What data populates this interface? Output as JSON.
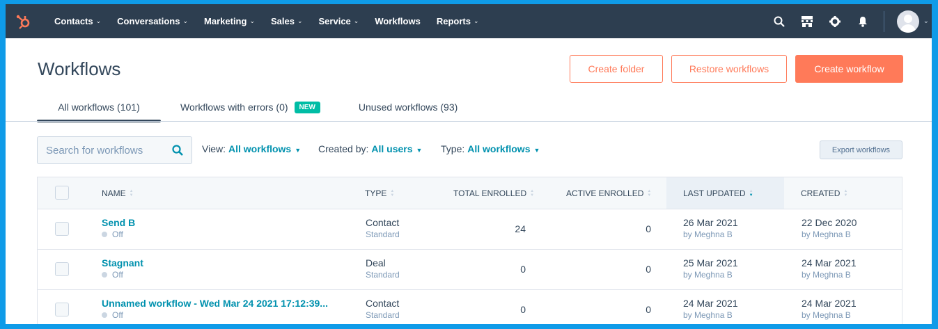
{
  "nav": {
    "items": [
      {
        "label": "Contacts",
        "has_dropdown": true
      },
      {
        "label": "Conversations",
        "has_dropdown": true
      },
      {
        "label": "Marketing",
        "has_dropdown": true
      },
      {
        "label": "Sales",
        "has_dropdown": true
      },
      {
        "label": "Service",
        "has_dropdown": true
      },
      {
        "label": "Workflows",
        "has_dropdown": false
      },
      {
        "label": "Reports",
        "has_dropdown": true
      }
    ],
    "icons": [
      "search-icon",
      "marketplace-icon",
      "settings-icon",
      "notifications-icon"
    ],
    "chevron": "⌄"
  },
  "header": {
    "title": "Workflows",
    "create_folder_label": "Create folder",
    "restore_label": "Restore workflows",
    "create_workflow_label": "Create workflow"
  },
  "tabs": [
    {
      "label": "All workflows (101)",
      "active": true
    },
    {
      "label": "Workflows with errors (0)",
      "badge": "NEW"
    },
    {
      "label": "Unused workflows (93)"
    }
  ],
  "filters": {
    "search_placeholder": "Search for workflows",
    "view_label": "View:",
    "view_value": "All workflows",
    "created_by_label": "Created by:",
    "created_by_value": "All users",
    "type_label": "Type:",
    "type_value": "All workflows",
    "export_label": "Export workflows"
  },
  "table": {
    "columns": {
      "name": "NAME",
      "type": "TYPE",
      "total_enrolled": "TOTAL ENROLLED",
      "active_enrolled": "ACTIVE ENROLLED",
      "last_updated": "LAST UPDATED",
      "created": "CREATED"
    },
    "sorted_column": "last_updated",
    "rows": [
      {
        "name": "Send B",
        "status": "Off",
        "type": "Contact",
        "subtype": "Standard",
        "total_enrolled": "24",
        "active_enrolled": "0",
        "last_updated": "26 Mar 2021",
        "last_updated_by": "by Meghna B",
        "created": "22 Dec 2020",
        "created_by": "by Meghna B"
      },
      {
        "name": "Stagnant",
        "status": "Off",
        "type": "Deal",
        "subtype": "Standard",
        "total_enrolled": "0",
        "active_enrolled": "0",
        "last_updated": "25 Mar 2021",
        "last_updated_by": "by Meghna B",
        "created": "24 Mar 2021",
        "created_by": "by Meghna B"
      },
      {
        "name": "Unnamed workflow - Wed Mar 24 2021 17:12:39...",
        "status": "Off",
        "type": "Contact",
        "subtype": "Standard",
        "total_enrolled": "0",
        "active_enrolled": "0",
        "last_updated": "24 Mar 2021",
        "last_updated_by": "by Meghna B",
        "created": "24 Mar 2021",
        "created_by": "by Meghna B"
      }
    ]
  },
  "colors": {
    "nav_bg": "#2d3e50",
    "accent_orange": "#ff7a59",
    "link_teal": "#0091ae",
    "badge_green": "#00bda5",
    "frame_border": "#0f9be8"
  }
}
